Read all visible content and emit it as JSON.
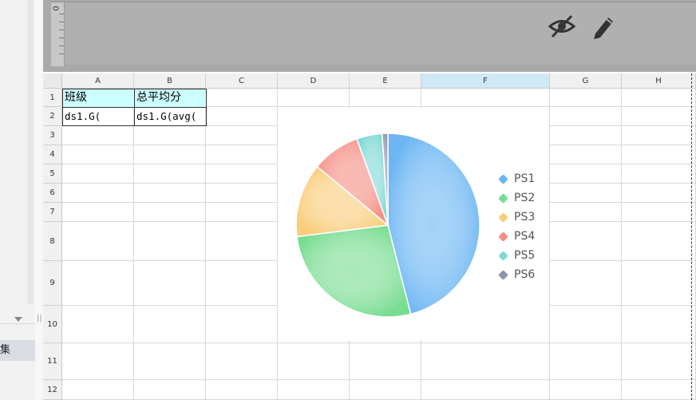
{
  "panel": {
    "item_label": "集"
  },
  "ruler": {
    "zero": "0"
  },
  "columns": [
    "A",
    "B",
    "C",
    "D",
    "E",
    "F",
    "G",
    "H"
  ],
  "rows": [
    "1",
    "2",
    "3",
    "4",
    "5",
    "6",
    "7",
    "8",
    "9",
    "10",
    "11",
    "12"
  ],
  "cells": {
    "a1": "班级",
    "b1": "总平均分",
    "a2": "ds1.G(",
    "b2": "ds1.G(avg("
  },
  "icons": [
    "eye-slash-icon",
    "pencil-icon",
    "chevron-down-icon"
  ],
  "chart_data": {
    "type": "pie",
    "title": "",
    "categories": [
      "PS1",
      "PS2",
      "PS3",
      "PS4",
      "PS5",
      "PS6"
    ],
    "values": [
      46,
      27,
      13,
      8.5,
      4.5,
      1
    ],
    "colors": [
      "#6cb6f3",
      "#78dc91",
      "#f9cd7a",
      "#f58f84",
      "#7fd9d6",
      "#8f94ad"
    ],
    "legend": [
      "PS1",
      "PS2",
      "PS3",
      "PS4",
      "PS5",
      "PS6"
    ],
    "legend_position": "right"
  }
}
